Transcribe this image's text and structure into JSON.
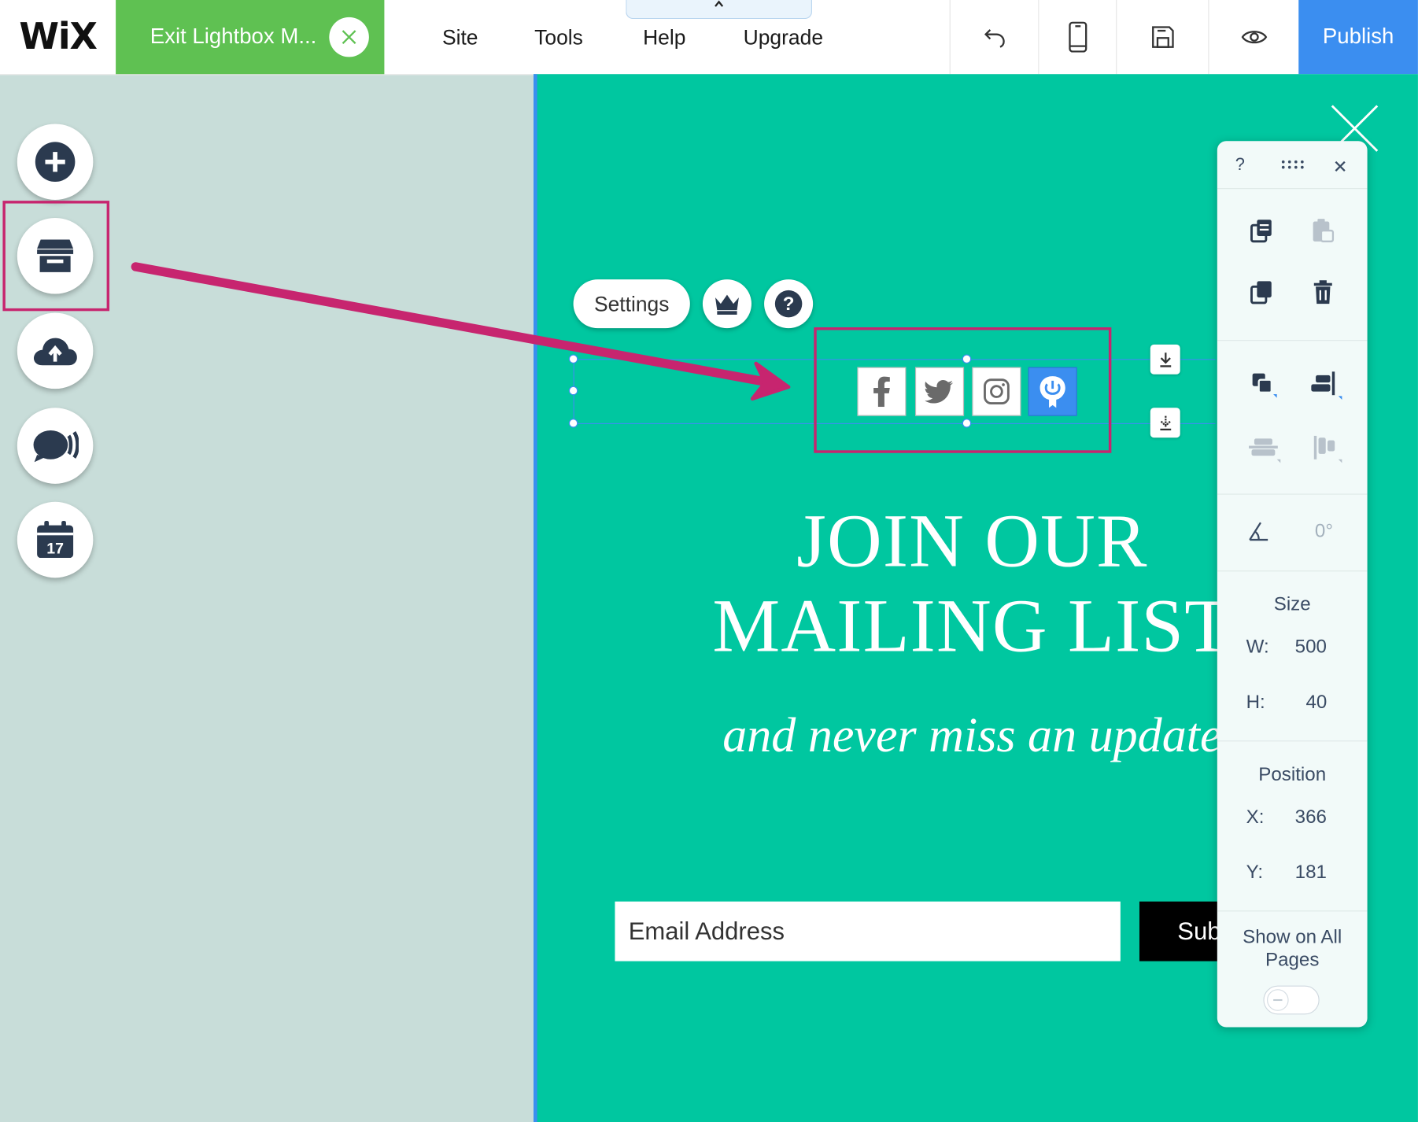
{
  "topbar": {
    "logo": "WiX",
    "exit_tab_label": "Exit Lightbox M...",
    "menu": [
      "Site",
      "Tools",
      "Help",
      "Upgrade"
    ],
    "publish_label": "Publish"
  },
  "left_tools": [
    "add-icon",
    "store-icon",
    "upload-cloud-icon",
    "chat-icon",
    "calendar-icon"
  ],
  "toolbar": {
    "settings_label": "Settings"
  },
  "social_bar": [
    "facebook-icon",
    "twitter-icon",
    "instagram-icon",
    "power-app-icon"
  ],
  "content": {
    "headline_line1": "JOIN OUR",
    "headline_line2": "MAILING LIST",
    "subline": "and never miss an update",
    "email_placeholder": "Email Address",
    "subscribe_label": "Subscribe"
  },
  "panel": {
    "help": "?",
    "rotation_value": "0°",
    "size_label": "Size",
    "w_label": "W:",
    "w_value": "500",
    "h_label": "H:",
    "h_value": "40",
    "position_label": "Position",
    "x_label": "X:",
    "x_value": "366",
    "y_label": "Y:",
    "y_value": "181",
    "show_all_line1": "Show on All",
    "show_all_line2": "Pages"
  },
  "colors": {
    "accent_blue": "#3b8ef0",
    "exit_green": "#5fc152",
    "canvas_teal": "#00c7a0",
    "highlight_magenta": "#c7256f"
  }
}
